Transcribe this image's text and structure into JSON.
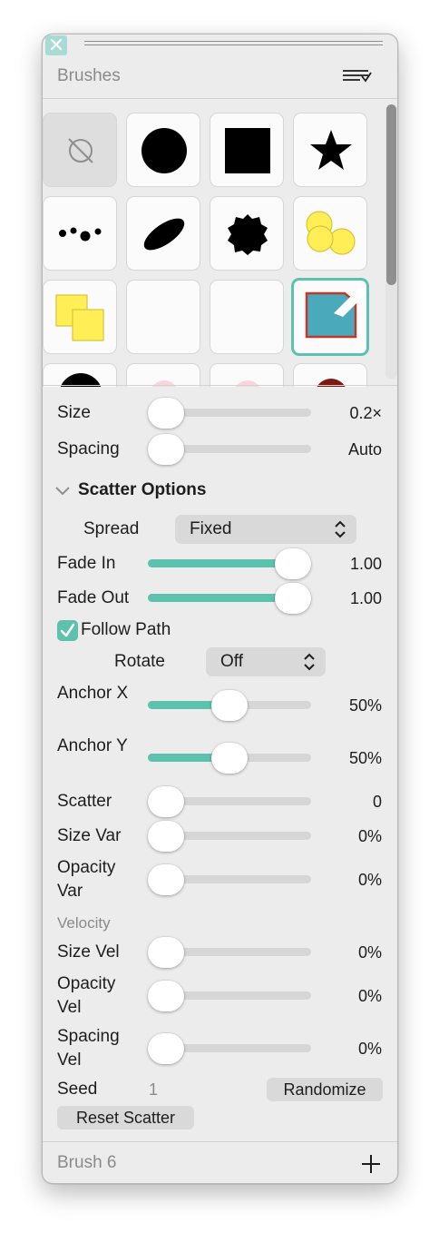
{
  "window": {
    "close_icon": "close-icon"
  },
  "header": {
    "title": "Brushes",
    "menu_icon": "list-menu-icon"
  },
  "brushes": [
    {
      "name": "no-brush",
      "icon": "no-brush-icon"
    },
    {
      "name": "circle",
      "icon": "circle-brush-icon"
    },
    {
      "name": "square",
      "icon": "square-brush-icon"
    },
    {
      "name": "star",
      "icon": "star-brush-icon"
    },
    {
      "name": "dots",
      "icon": "dots-brush-icon"
    },
    {
      "name": "ellipse",
      "icon": "ellipse-brush-icon"
    },
    {
      "name": "splat",
      "icon": "splat-brush-icon"
    },
    {
      "name": "yellow-circles",
      "icon": "yellow-circles-brush-icon"
    },
    {
      "name": "yellow-squares",
      "icon": "yellow-squares-brush-icon"
    },
    {
      "name": "empty-1",
      "icon": "blank-brush-icon"
    },
    {
      "name": "empty-2",
      "icon": "blank-brush-icon"
    },
    {
      "name": "teal-shape",
      "icon": "teal-shape-brush-icon",
      "selected": true
    }
  ],
  "size": {
    "label": "Size",
    "value": "0.2×",
    "level": 0.0
  },
  "spacing": {
    "label": "Spacing",
    "value": "Auto",
    "level": 0.0
  },
  "scatter_options": {
    "title": "Scatter Options",
    "spread": {
      "label": "Spread",
      "value": "Fixed"
    },
    "fade_in": {
      "label": "Fade In",
      "value": "1.00",
      "level": 1.0
    },
    "fade_out": {
      "label": "Fade Out",
      "value": "1.00",
      "level": 1.0
    },
    "follow_path": {
      "label": "Follow Path",
      "checked": true
    },
    "rotate": {
      "label": "Rotate",
      "value": "Off"
    },
    "anchor_x": {
      "label": "Anchor X",
      "value": "50%",
      "level": 0.5
    },
    "anchor_y": {
      "label": "Anchor Y",
      "value": "50%",
      "level": 0.5
    },
    "scatter": {
      "label": "Scatter",
      "value": "0",
      "level": 0.0
    },
    "size_var": {
      "label": "Size Var",
      "value": "0%",
      "level": 0.0
    },
    "opacity_var": {
      "label": "Opacity Var",
      "value": "0%",
      "level": 0.0
    },
    "velocity_heading": "Velocity",
    "size_vel": {
      "label": "Size Vel",
      "value": "0%",
      "level": 0.0
    },
    "opacity_vel": {
      "label": "Opacity Vel",
      "value": "0%",
      "level": 0.0
    },
    "spacing_vel": {
      "label": "Spacing Vel",
      "value": "0%",
      "level": 0.0
    },
    "seed": {
      "label": "Seed",
      "value": "1"
    },
    "randomize_label": "Randomize",
    "reset_label": "Reset Scatter"
  },
  "footer": {
    "brush_name": "Brush 6",
    "add_icon": "plus-icon"
  },
  "colors": {
    "accent": "#5cc1ad",
    "panel_bg": "#ececec",
    "track": "#d6d6d6"
  }
}
